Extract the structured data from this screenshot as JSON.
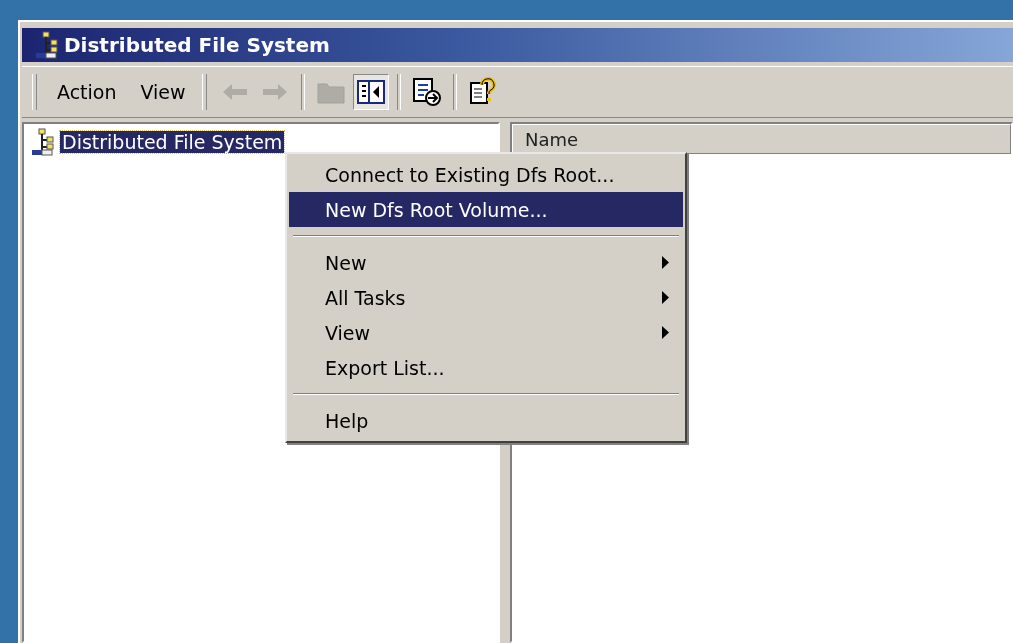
{
  "window": {
    "title": "Distributed File System"
  },
  "menu_bar": [
    {
      "label": "Action"
    },
    {
      "label": "View"
    }
  ],
  "toolbar": [
    {
      "kind": "back",
      "disabled": true,
      "pressed": false
    },
    {
      "kind": "forward",
      "disabled": true,
      "pressed": false
    },
    {
      "kind": "separator"
    },
    {
      "kind": "up",
      "disabled": true,
      "pressed": false
    },
    {
      "kind": "tree",
      "disabled": false,
      "pressed": true
    },
    {
      "kind": "separator"
    },
    {
      "kind": "export",
      "disabled": false,
      "pressed": false
    },
    {
      "kind": "separator"
    },
    {
      "kind": "help",
      "disabled": false,
      "pressed": false
    }
  ],
  "tree": {
    "items": [
      {
        "label": "Distributed File System",
        "selected": true
      }
    ]
  },
  "list": {
    "columns": [
      "Name"
    ]
  },
  "context_menu": {
    "items": [
      {
        "kind": "item",
        "label": "Connect to Existing Dfs Root...",
        "selected": false,
        "submenu": false
      },
      {
        "kind": "item",
        "label": "New Dfs Root Volume...",
        "selected": true,
        "submenu": false
      },
      {
        "kind": "separator"
      },
      {
        "kind": "item",
        "label": "New",
        "selected": false,
        "submenu": true
      },
      {
        "kind": "item",
        "label": "All Tasks",
        "selected": false,
        "submenu": true
      },
      {
        "kind": "item",
        "label": "View",
        "selected": false,
        "submenu": true
      },
      {
        "kind": "item",
        "label": "Export List...",
        "selected": false,
        "submenu": false
      },
      {
        "kind": "separator"
      },
      {
        "kind": "item",
        "label": "Help",
        "selected": false,
        "submenu": false
      }
    ]
  }
}
